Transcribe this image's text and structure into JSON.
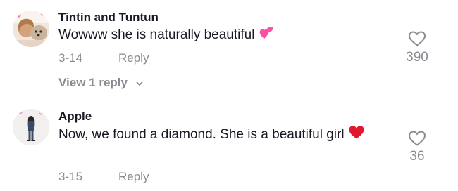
{
  "comments": [
    {
      "username": "Tintin and Tuntun",
      "text": "Wowww she is naturally beautiful",
      "emoji": "two-hearts",
      "date": "3-14",
      "reply_label": "Reply",
      "likes": "390",
      "view_replies_label": "View 1 reply"
    },
    {
      "username": "Apple",
      "text": "Now, we found a diamond. She is a beautiful girl",
      "emoji": "red-heart",
      "date": "3-15",
      "reply_label": "Reply",
      "likes": "36"
    }
  ],
  "colors": {
    "primary_text": "#161823",
    "secondary_text": "#8a8b91",
    "heart": "#e0182f",
    "pink_heart": "#ff4fa3"
  }
}
